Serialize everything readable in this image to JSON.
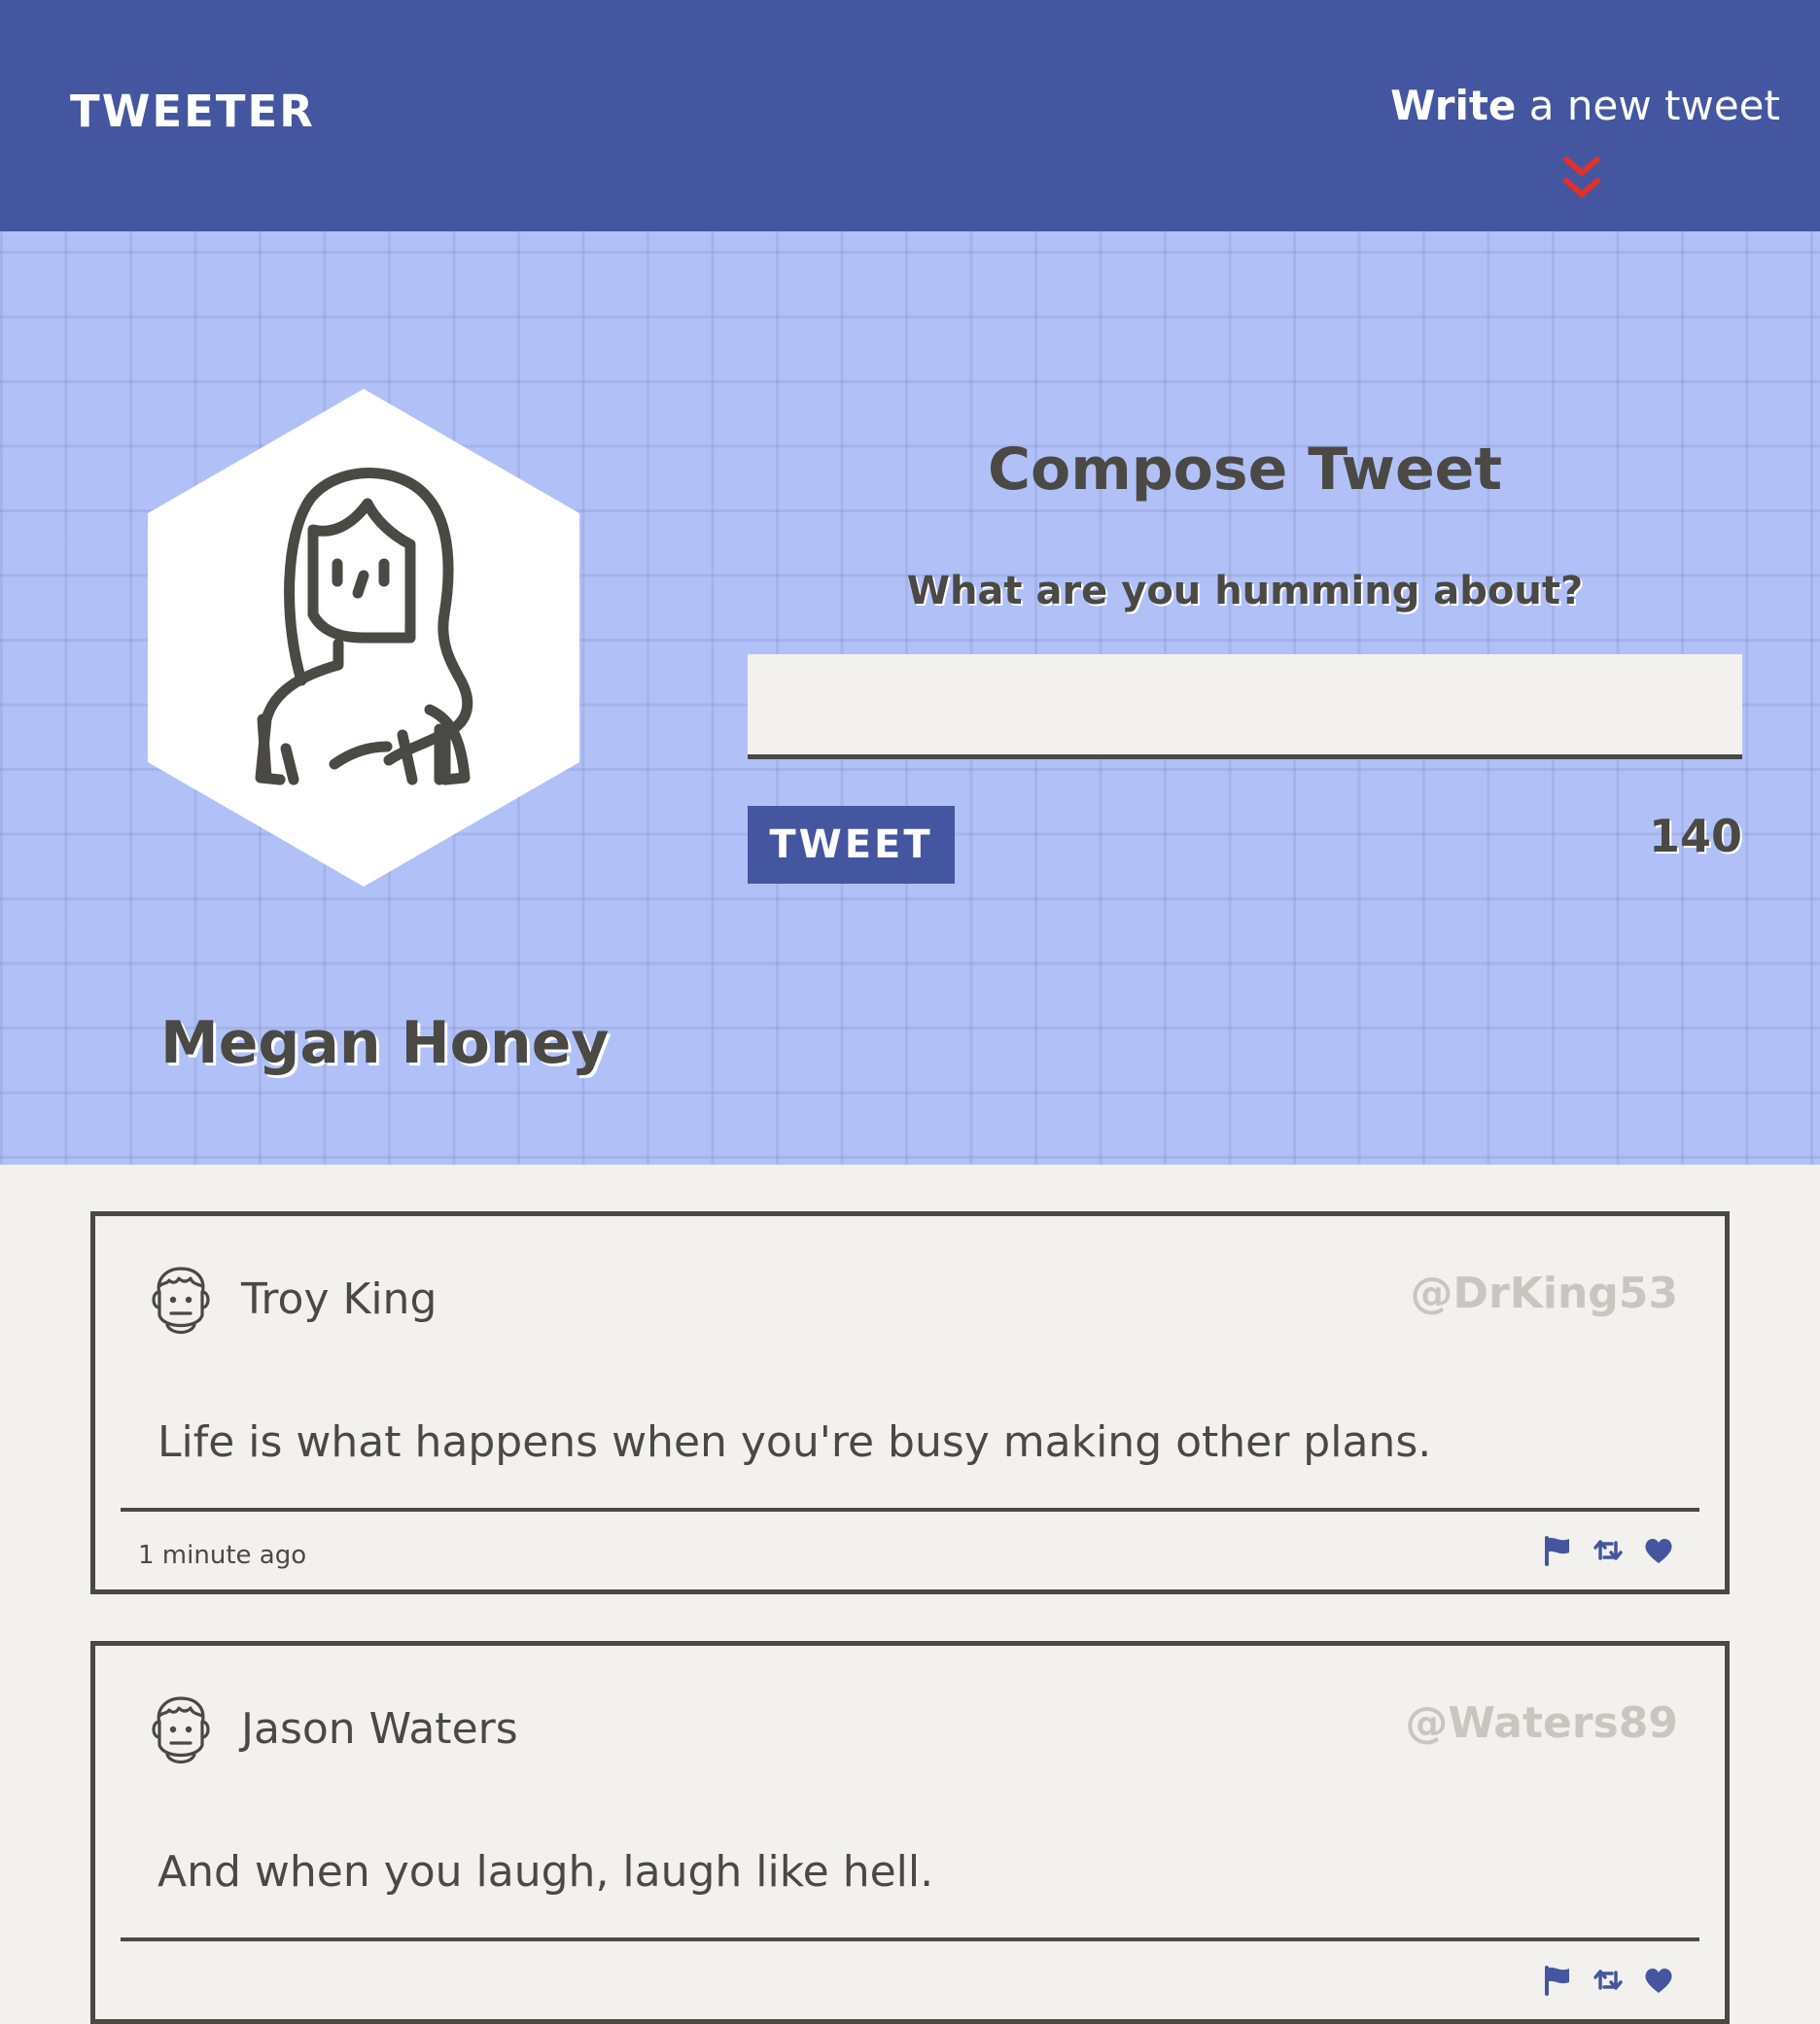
{
  "nav": {
    "brand": "TWEETER",
    "compose_toggle": {
      "strong": "Write",
      "rest": " a new tweet",
      "icon": "double-chevron-down-icon"
    }
  },
  "profile": {
    "name": "Megan Honey",
    "avatar_icon": "woman-avatar-icon"
  },
  "compose": {
    "title": "Compose Tweet",
    "label": "What are you humming about?",
    "input_value": "",
    "input_placeholder": "",
    "button_label": "TWEET",
    "char_counter": "140"
  },
  "tweets": [
    {
      "author": "Troy King",
      "handle": "@DrKing53",
      "text": "Life is what happens when you're busy making other plans.",
      "time": "1 minute ago",
      "avatar_icon": "man-avatar-icon",
      "actions": [
        "flag-icon",
        "retweet-icon",
        "heart-icon"
      ]
    },
    {
      "author": "Jason Waters",
      "handle": "@Waters89",
      "text": "And when you laugh, laugh like hell.",
      "avatar_icon": "man-avatar-icon",
      "actions": [
        "flag-icon",
        "retweet-icon",
        "heart-icon"
      ]
    }
  ],
  "colors": {
    "nav_bg": "#4456a0",
    "header_bg": "#b1c1f8",
    "page_bg": "#f2f1ed",
    "text": "#4a4944",
    "accent_red": "#e0312a",
    "handle": "#c7c6c0"
  }
}
